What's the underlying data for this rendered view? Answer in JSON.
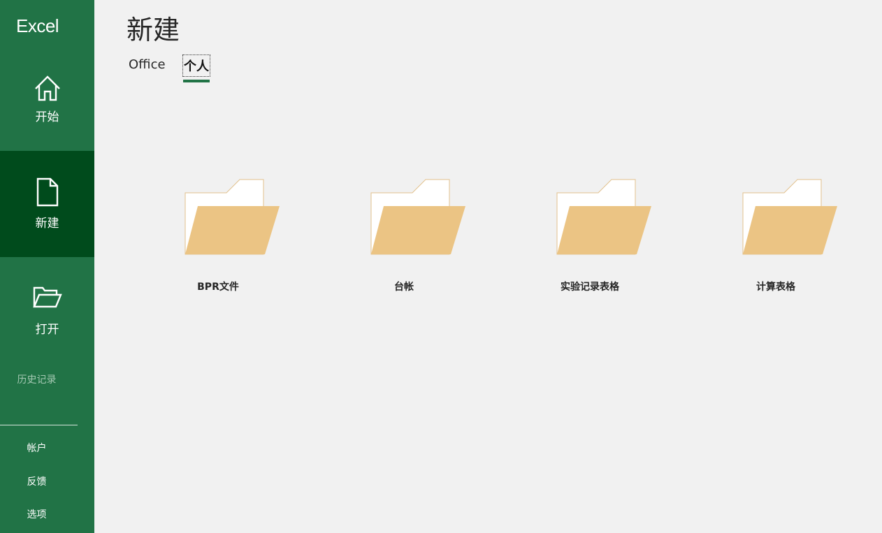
{
  "sidebar": {
    "brand": "Excel",
    "items": [
      {
        "label": "开始",
        "icon": "home-icon"
      },
      {
        "label": "新建",
        "icon": "new-document-icon"
      },
      {
        "label": "打开",
        "icon": "open-folder-icon"
      }
    ],
    "history_label": "历史记录",
    "bottom": {
      "account": "帐户",
      "feedback": "反馈",
      "options": "选项"
    }
  },
  "main": {
    "title": "新建",
    "tabs": [
      {
        "label": "Office"
      },
      {
        "label": "个人"
      }
    ],
    "folders": [
      {
        "label": "BPR文件",
        "icon": "folder-icon"
      },
      {
        "label": "台帐",
        "icon": "folder-icon"
      },
      {
        "label": "实验记录表格",
        "icon": "folder-icon"
      },
      {
        "label": "计算表格",
        "icon": "folder-icon"
      }
    ]
  },
  "colors": {
    "sidebar_bg": "#217346",
    "sidebar_active_bg": "#004b1c",
    "accent": "#217346",
    "folder_front": "#ebc484",
    "folder_back": "#ffffff",
    "folder_outline": "#e2c18d",
    "page_bg": "#f1f1f1"
  }
}
